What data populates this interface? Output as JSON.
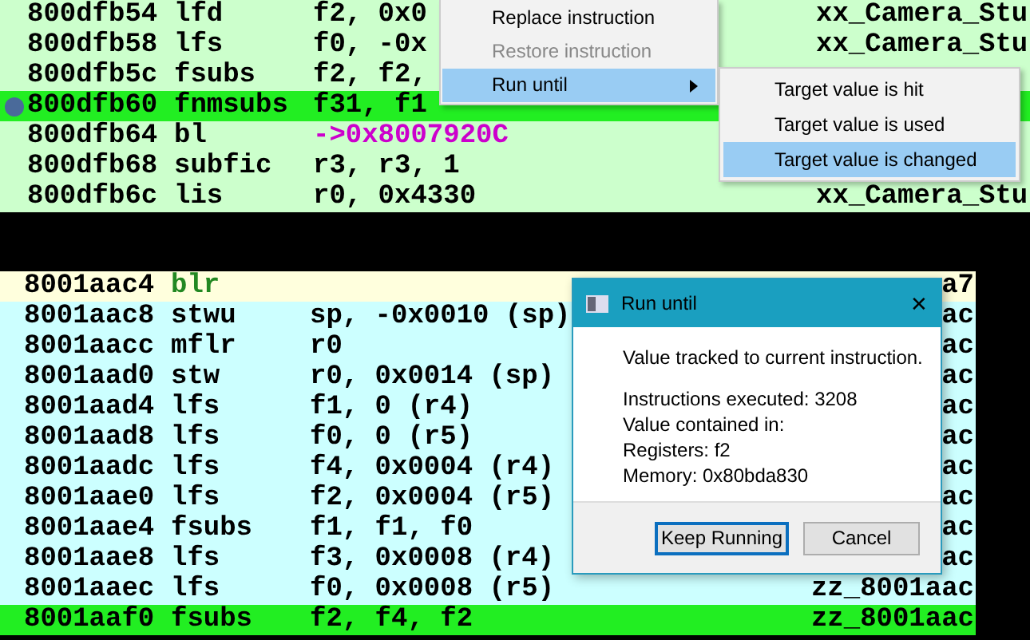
{
  "top_listing": {
    "rows": [
      {
        "address": "800dfb54",
        "mnemonic": "lfd",
        "operands": "f2, 0x0",
        "symbol": "xx_Camera_Stu",
        "kind": "normal",
        "executing": false,
        "breakpoint": false
      },
      {
        "address": "800dfb58",
        "mnemonic": "lfs",
        "operands": "f0, -0x",
        "symbol": "xx_Camera_Stu",
        "kind": "normal",
        "executing": false,
        "breakpoint": false
      },
      {
        "address": "800dfb5c",
        "mnemonic": "fsubs",
        "operands": "f2, f2,",
        "kind": "normal",
        "executing": false,
        "breakpoint": false
      },
      {
        "address": "800dfb60",
        "mnemonic": "fnmsubs",
        "operands": "f31, f1",
        "kind": "normal",
        "executing": true,
        "breakpoint": true
      },
      {
        "address": "800dfb64",
        "mnemonic": "bl",
        "operands": "->0x8007920C",
        "kind": "branch",
        "executing": false,
        "breakpoint": false
      },
      {
        "address": "800dfb68",
        "mnemonic": "subfic",
        "operands": "r3, r3, 1",
        "kind": "normal",
        "executing": false,
        "breakpoint": false
      },
      {
        "address": "800dfb6c",
        "mnemonic": "lis",
        "operands": "r0, 0x4330",
        "symbol": "xx_Camera_Stu",
        "kind": "normal",
        "executing": false,
        "breakpoint": false
      }
    ]
  },
  "context_menu": {
    "items": [
      {
        "label": "Replace instruction",
        "kind": "action",
        "disabled": false,
        "selected": false
      },
      {
        "label": "Restore instruction",
        "kind": "action",
        "disabled": true,
        "selected": false
      },
      {
        "label": "Run until",
        "kind": "submenu",
        "disabled": false,
        "selected": true
      }
    ]
  },
  "submenu": {
    "items": [
      {
        "label": "Target value is hit",
        "selected": false
      },
      {
        "label": "Target value is used",
        "selected": false
      },
      {
        "label": "Target value is changed",
        "selected": true
      }
    ]
  },
  "bottom_listing": {
    "rows": [
      {
        "address": "8001aac4",
        "mnemonic": "blr",
        "operands": "",
        "symbol": "a7",
        "kind": "return",
        "executing": false,
        "selected": true
      },
      {
        "address": "8001aac8",
        "mnemonic": "stwu",
        "operands": "sp, -0x0010 (sp)",
        "symbol": "ac",
        "kind": "normal",
        "executing": false,
        "selected": false
      },
      {
        "address": "8001aacc",
        "mnemonic": "mflr",
        "operands": "r0",
        "symbol": "ac",
        "kind": "normal",
        "executing": false,
        "selected": false
      },
      {
        "address": "8001aad0",
        "mnemonic": "stw",
        "operands": "r0, 0x0014 (sp)",
        "symbol": "ac",
        "kind": "normal",
        "executing": false,
        "selected": false
      },
      {
        "address": "8001aad4",
        "mnemonic": "lfs",
        "operands": "f1, 0 (r4)",
        "symbol": "ac",
        "kind": "normal",
        "executing": false,
        "selected": false
      },
      {
        "address": "8001aad8",
        "mnemonic": "lfs",
        "operands": "f0, 0 (r5)",
        "symbol": "ac",
        "kind": "normal",
        "executing": false,
        "selected": false
      },
      {
        "address": "8001aadc",
        "mnemonic": "lfs",
        "operands": "f4, 0x0004 (r4)",
        "symbol": "ac",
        "kind": "normal",
        "executing": false,
        "selected": false
      },
      {
        "address": "8001aae0",
        "mnemonic": "lfs",
        "operands": "f2, 0x0004 (r5)",
        "symbol": "ac",
        "kind": "normal",
        "executing": false,
        "selected": false
      },
      {
        "address": "8001aae4",
        "mnemonic": "fsubs",
        "operands": "f1, f1, f0",
        "symbol": "ac",
        "kind": "normal",
        "executing": false,
        "selected": false
      },
      {
        "address": "8001aae8",
        "mnemonic": "lfs",
        "operands": "f3, 0x0008 (r4)",
        "symbol": "ac",
        "kind": "normal",
        "executing": false,
        "selected": false
      },
      {
        "address": "8001aaec",
        "mnemonic": "lfs",
        "operands": "f0, 0x0008 (r5)",
        "symbol": "zz_8001aac",
        "kind": "normal",
        "executing": false,
        "selected": false
      },
      {
        "address": "8001aaf0",
        "mnemonic": "fsubs",
        "operands": "f2, f4, f2",
        "symbol": "zz_8001aac",
        "kind": "normal",
        "executing": true,
        "selected": false
      }
    ]
  },
  "dialog": {
    "title": "Run until",
    "close": "✕",
    "message": "Value tracked to current instruction.",
    "details": [
      "Instructions executed:  3208",
      "Value contained in:",
      "Registers:  f2",
      "Memory:  0x80bda830"
    ],
    "buttons": [
      {
        "label": "Keep Running",
        "default": true
      },
      {
        "label": "Cancel",
        "default": false
      }
    ]
  }
}
